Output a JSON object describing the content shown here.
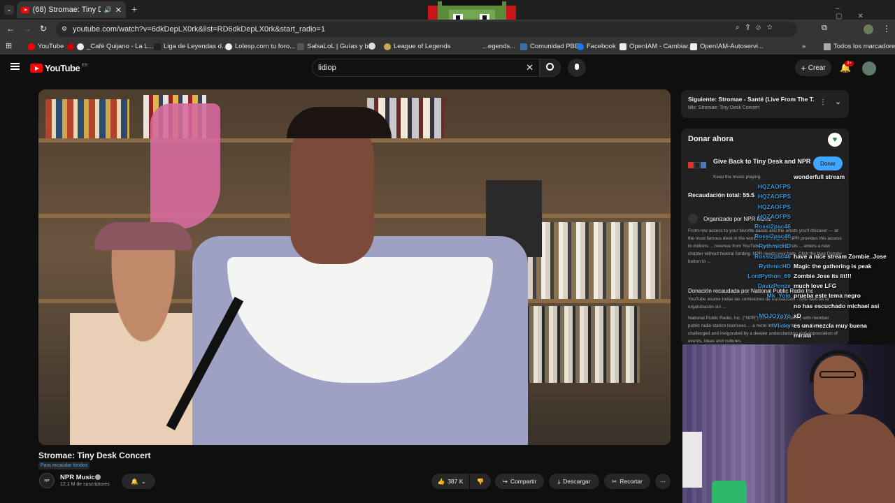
{
  "browser": {
    "tab_title": "(68) Stromae: Tiny Desk Co",
    "url": "youtube.com/watch?v=6dkDepLX0rk&list=RD6dkDepLX0rk&start_radio=1",
    "bookmarks": [
      "YouTube",
      "_Café Quijano - La L...",
      "Liga de Leyendas d...",
      "Lolesp.com tu foro...",
      "SalsaLoL | Guías y b...",
      "League of Legends",
      "...egends...",
      "Comunidad PBE",
      "Facebook",
      "OpenIAM - Cambiar...",
      "OpenIAM-Autoservi..."
    ],
    "all_bookmarks": "Todos los marcadores"
  },
  "youtube": {
    "logo": "YouTube",
    "region": "ES",
    "search_value": "lidiop",
    "create_label": "Crear",
    "notif_count": "9+"
  },
  "video": {
    "title": "Stromae: Tiny Desk Concert",
    "fundraiser_tag": "Para recaudar fondos",
    "npr_logo": [
      "n",
      "p",
      "r"
    ],
    "channel": "NPR Music",
    "subscribers": "12,1 M de suscriptores",
    "likes": "387 K",
    "share": "Compartir",
    "download": "Descargar",
    "clip": "Recortar"
  },
  "up_next": {
    "label": "Siguiente: Stromae - Santé (Live From The T...",
    "mix": "Mix: Stromae: Tiny Desk Concert"
  },
  "donation": {
    "header": "Donar ahora",
    "campaign": "Give Back to Tiny Desk and NPR",
    "sub": "Keep the music playing.",
    "button": "Donar",
    "raised": "Recaudación total: 55.5",
    "organizer": "Organizado por NPR Music",
    "body": "Front-row access to your favorite bands and the artists you'll discover — at the most famous desk in the world. As a nonprofit, NPR provides this access to millions ... revenue from YouTube goes to the artists ... enters a new chapter without federal funding. NPR needs your help. Click the blue Donate button to ...",
    "collected_by": "Donación recaudada por National Public Radio Inc",
    "fees": "YouTube asume todas las comisiones de transacción · Sitio web de la organización sin ...",
    "about": "National Public Radio, Inc. (\"NPR\") works collaboratively with member public radio station licensees ... a more informed public, one that is challenged and invigorated by a deeper understanding and appreciation of events, ideas and cultures."
  },
  "chat": [
    {
      "name": "",
      "msg": "wonderfull stream"
    },
    {
      "name": "HQZAOFPS",
      "msg": ""
    },
    {
      "name": "HQZAOFPS",
      "msg": ""
    },
    {
      "name": "HQZAOFPS",
      "msg": ""
    },
    {
      "name": "HQZAOFPS",
      "msg": ""
    },
    {
      "name": "Rossi2pac46",
      "msg": ""
    },
    {
      "name": "Rossi2pac46",
      "msg": ""
    },
    {
      "name": "RythmicHD",
      "msg": ""
    },
    {
      "name": "Rossi2pac46",
      "msg": "have a nice stream Zombie_Jose"
    },
    {
      "name": "RythmicHD",
      "msg": "Magic the gathering is peak"
    },
    {
      "name": "LordPython_69",
      "msg": "Zombie Jose its lit!!!"
    },
    {
      "name": "DavizPonze",
      "msg": "much love LFG"
    },
    {
      "name": "Mk_Yolo",
      "msg": "prueba este tema negro"
    },
    {
      "name": "",
      "msg": "no has escuchado michael asi"
    },
    {
      "name": "MOJOYoYo",
      "msg": "xD"
    },
    {
      "name": "Vlicky",
      "msg": "es una mezcla muy buena"
    },
    {
      "name": "",
      "msg": "mirala"
    }
  ]
}
